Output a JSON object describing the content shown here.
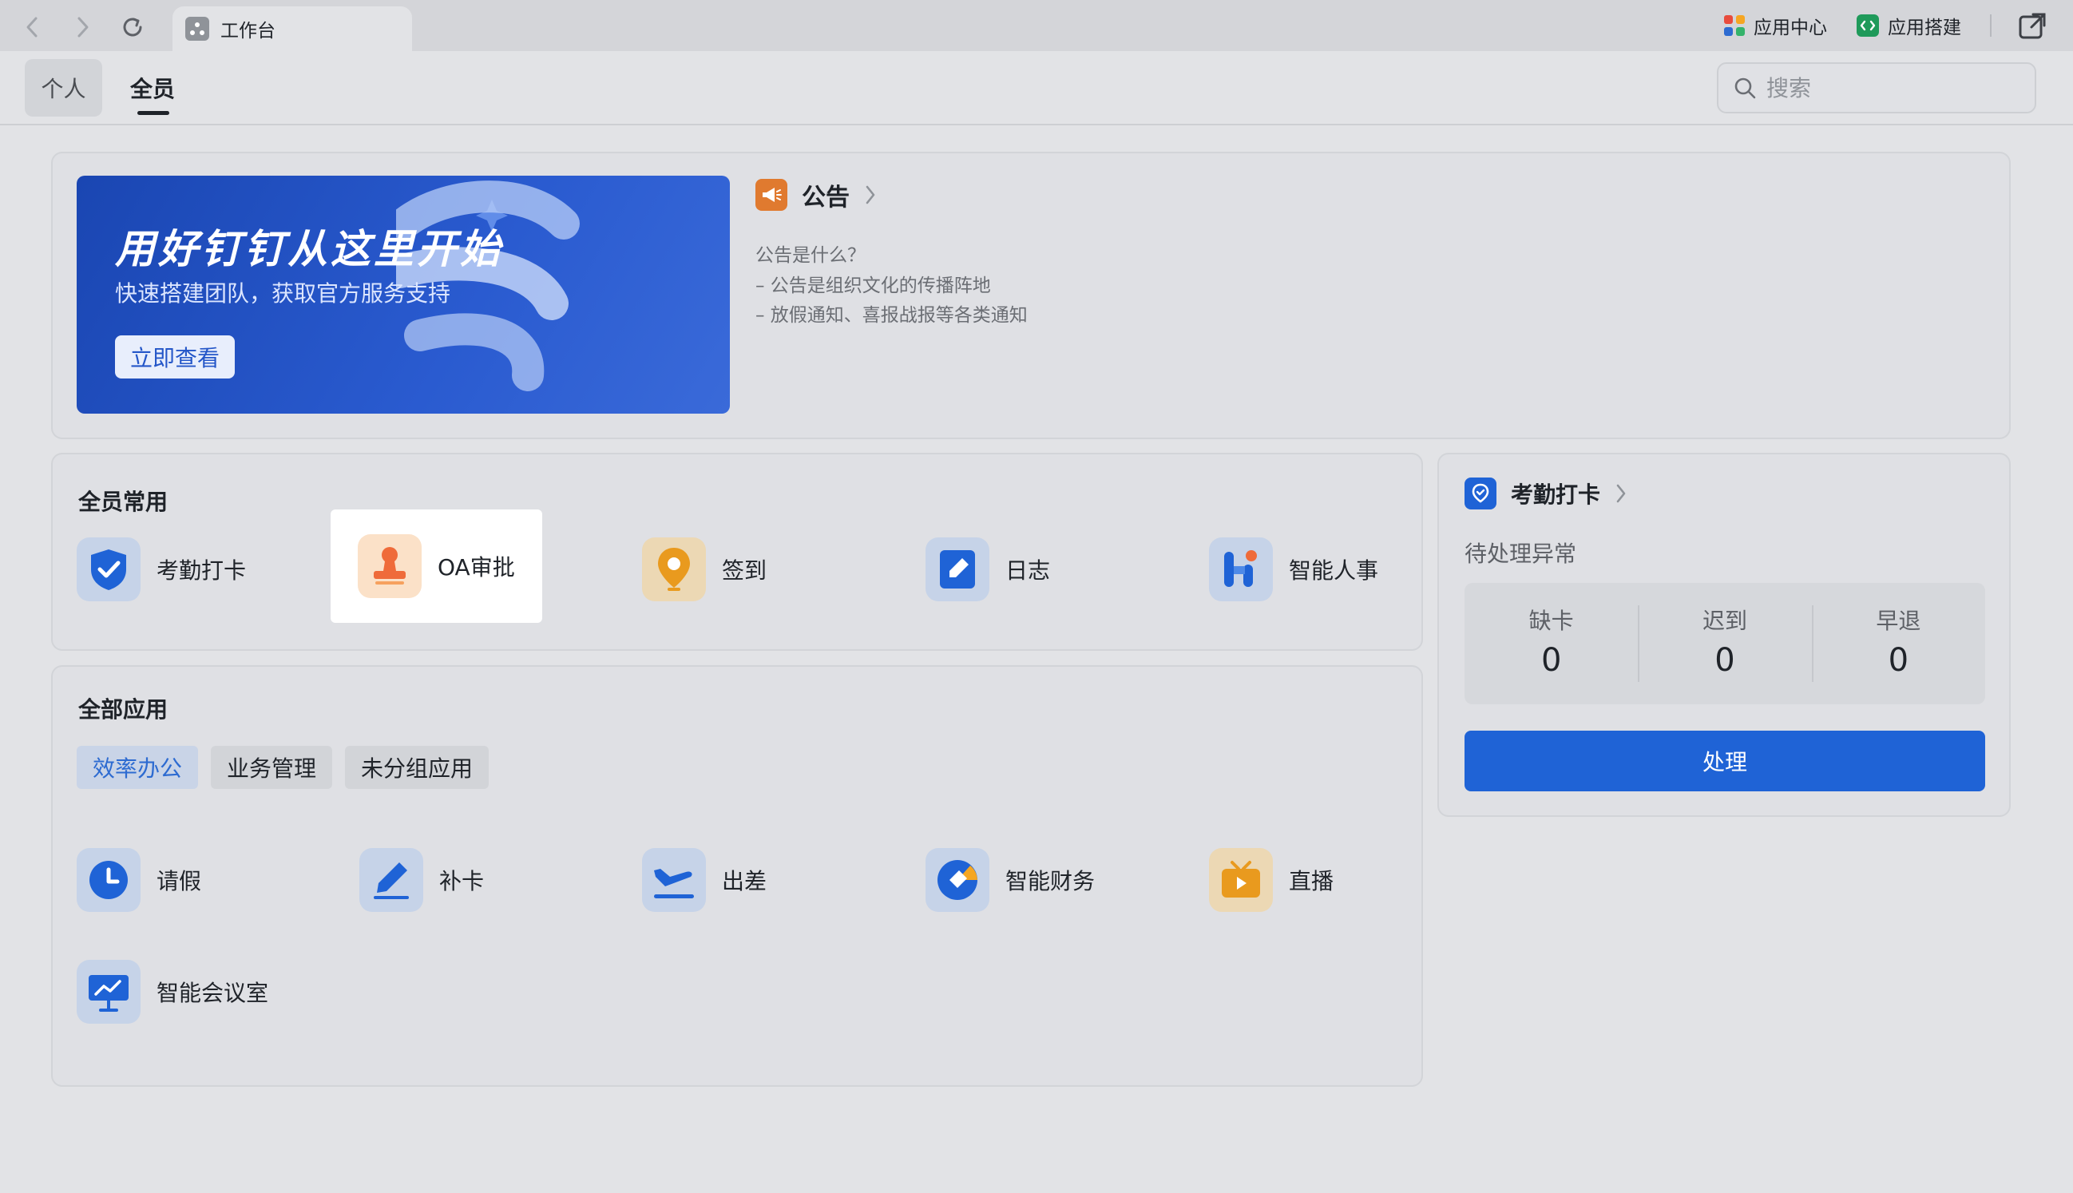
{
  "window": {
    "tab_title": "工作台"
  },
  "toplinks": {
    "app_center": "应用中心",
    "app_builder": "应用搭建"
  },
  "header": {
    "tabs": [
      {
        "label": "个人"
      },
      {
        "label": "全员"
      }
    ],
    "search_placeholder": "搜索"
  },
  "banner": {
    "title": "用好钉钉从这里开始",
    "subtitle": "快速搭建团队，获取官方服务支持",
    "button": "立即查看"
  },
  "notice": {
    "title": "公告",
    "lines": [
      "公告是什么？",
      "– 公告是组织文化的传播阵地",
      "– 放假通知、喜报战报等各类通知"
    ]
  },
  "common_apps": {
    "title": "全员常用",
    "items": [
      {
        "label": "考勤打卡",
        "icon": "check-shield-icon"
      },
      {
        "label": "OA审批",
        "icon": "stamp-icon"
      },
      {
        "label": "签到",
        "icon": "location-pin-icon"
      },
      {
        "label": "日志",
        "icon": "notebook-icon"
      },
      {
        "label": "智能人事",
        "icon": "hr-icon"
      }
    ]
  },
  "all_apps": {
    "title": "全部应用",
    "chips": [
      "效率办公",
      "业务管理",
      "未分组应用"
    ],
    "items": [
      {
        "label": "请假",
        "icon": "clock-icon"
      },
      {
        "label": "补卡",
        "icon": "pen-icon"
      },
      {
        "label": "出差",
        "icon": "airplane-icon"
      },
      {
        "label": "智能财务",
        "icon": "finance-icon"
      },
      {
        "label": "直播",
        "icon": "tv-play-icon"
      },
      {
        "label": "智能会议室",
        "icon": "meeting-board-icon"
      }
    ]
  },
  "attendance": {
    "title": "考勤打卡",
    "subtitle": "待处理异常",
    "stats": [
      {
        "label": "缺卡",
        "value": "0"
      },
      {
        "label": "迟到",
        "value": "0"
      },
      {
        "label": "早退",
        "value": "0"
      }
    ],
    "button": "处理"
  },
  "colors": {
    "primary": "#1f63d6",
    "active_chip_text": "#2d6bd1",
    "banner": "#2a5bd0",
    "notice_icon": "#e07a2f"
  }
}
